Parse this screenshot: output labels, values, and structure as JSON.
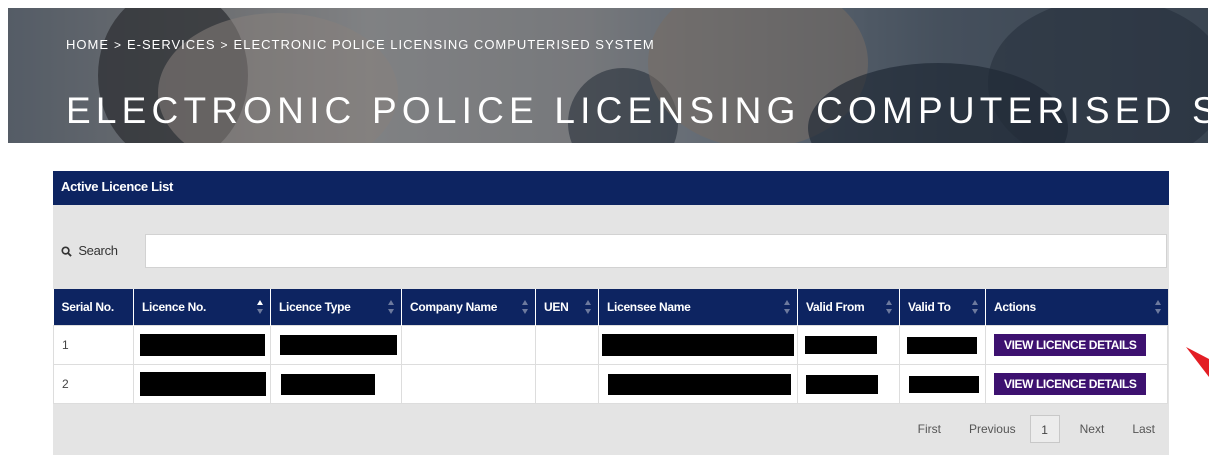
{
  "breadcrumb": {
    "items": [
      "HOME",
      "E-SERVICES",
      "ELECTRONIC POLICE LICENSING COMPUTERISED SYSTEM"
    ],
    "sep1": ">",
    "sep2": ">"
  },
  "page_title": "ELECTRONIC POLICE LICENSING COMPUTERISED SYSTEM",
  "panel": {
    "title": "Active Licence List",
    "search_label": "Search",
    "search_value": ""
  },
  "table": {
    "columns": [
      "Serial No.",
      "Licence No.",
      "Licence Type",
      "Company Name",
      "UEN",
      "Licensee Name",
      "Valid From",
      "Valid To",
      "Actions"
    ],
    "rows": [
      {
        "serial": "1",
        "action_label": "VIEW LICENCE DETAILS"
      },
      {
        "serial": "2",
        "action_label": "VIEW LICENCE DETAILS"
      }
    ]
  },
  "pagination": {
    "first": "First",
    "previous": "Previous",
    "current_page": "1",
    "next": "Next",
    "last": "Last"
  },
  "colors": {
    "header_navy": "#0d2461",
    "button_purple": "#3d1170",
    "annotation_red": "#e31e24"
  },
  "icons": {
    "search": "search-icon",
    "sort": "sort-icon",
    "annotation": "red-arrow-icon"
  }
}
